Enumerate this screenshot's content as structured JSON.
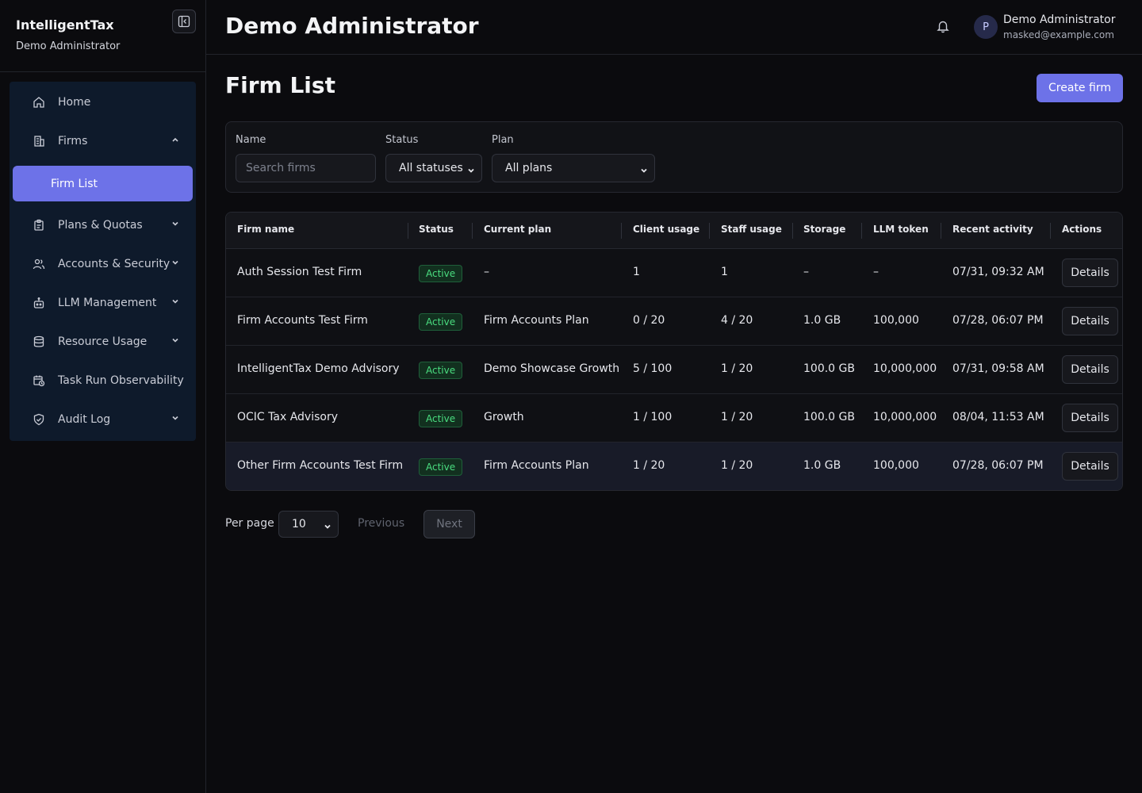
{
  "app": {
    "name": "IntelligentTax",
    "role": "Demo Administrator"
  },
  "header": {
    "title": "Demo Administrator",
    "user": {
      "initial": "P",
      "name": "Demo Administrator",
      "email": "masked@example.com"
    }
  },
  "sidebar": {
    "items": [
      {
        "label": "Home",
        "icon": "home-icon"
      },
      {
        "label": "Firms",
        "icon": "building-icon",
        "expanded": true
      },
      {
        "label": "Plans & Quotas",
        "icon": "clipboard-icon"
      },
      {
        "label": "Accounts & Security",
        "icon": "users-icon"
      },
      {
        "label": "LLM Management",
        "icon": "robot-icon"
      },
      {
        "label": "Resource Usage",
        "icon": "database-icon"
      },
      {
        "label": "Task Run Observability",
        "icon": "calendar-clock-icon"
      },
      {
        "label": "Audit Log",
        "icon": "shield-check-icon"
      }
    ],
    "active_sub": "Firm List"
  },
  "page": {
    "title": "Firm List",
    "create_label": "Create firm"
  },
  "filters": {
    "name_label": "Name",
    "name_placeholder": "Search firms",
    "status_label": "Status",
    "status_value": "All statuses",
    "plan_label": "Plan",
    "plan_value": "All plans"
  },
  "table": {
    "columns": [
      "Firm name",
      "Status",
      "Current plan",
      "Client usage",
      "Staff usage",
      "Storage",
      "LLM token",
      "Recent activity",
      "Actions"
    ],
    "rows": [
      {
        "name": "Auth Session Test Firm",
        "status": "Active",
        "plan": "–",
        "client": "1",
        "staff": "1",
        "storage": "–",
        "tokens": "–",
        "activity": "07/31, 09:32 AM",
        "action": "Details"
      },
      {
        "name": "Firm Accounts Test Firm",
        "status": "Active",
        "plan": "Firm Accounts Plan",
        "client": "0 / 20",
        "staff": "4 / 20",
        "storage": "1.0 GB",
        "tokens": "100,000",
        "activity": "07/28, 06:07 PM",
        "action": "Details"
      },
      {
        "name": "IntelligentTax Demo Advisory",
        "status": "Active",
        "plan": "Demo Showcase Growth",
        "client": "5 / 100",
        "staff": "1 / 20",
        "storage": "100.0 GB",
        "tokens": "10,000,000",
        "activity": "07/31, 09:58 AM",
        "action": "Details"
      },
      {
        "name": "OCIC Tax Advisory",
        "status": "Active",
        "plan": "Growth",
        "client": "1 / 100",
        "staff": "1 / 20",
        "storage": "100.0 GB",
        "tokens": "10,000,000",
        "activity": "08/04, 11:53 AM",
        "action": "Details"
      },
      {
        "name": "Other Firm Accounts Test Firm",
        "status": "Active",
        "plan": "Firm Accounts Plan",
        "client": "1 / 20",
        "staff": "1 / 20",
        "storage": "1.0 GB",
        "tokens": "100,000",
        "activity": "07/28, 06:07 PM",
        "action": "Details"
      }
    ]
  },
  "pagination": {
    "per_page_label": "Per page",
    "per_page_value": "10",
    "previous": "Previous",
    "next": "Next"
  },
  "colors": {
    "accent": "#6d72e8",
    "active_badge": "#4ade80",
    "sidebar_bg": "#0e1a2b",
    "page_bg": "#0b0b0e"
  }
}
